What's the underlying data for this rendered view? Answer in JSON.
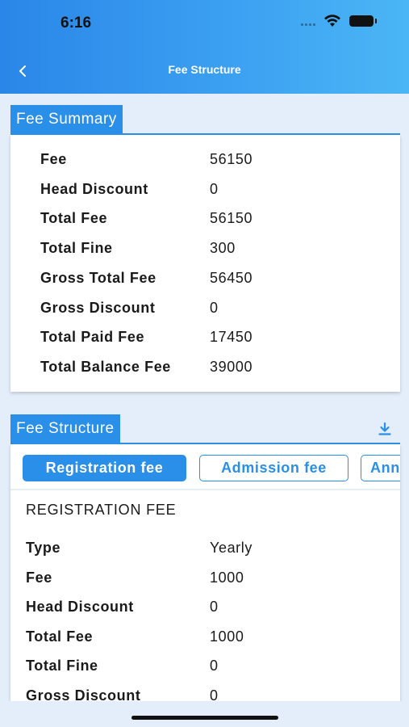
{
  "status_bar": {
    "time": "6:16"
  },
  "header": {
    "title": "Fee Structure"
  },
  "fee_summary": {
    "tab_label": "Fee Summary",
    "rows": [
      {
        "label": "Fee",
        "value": "56150"
      },
      {
        "label": "Head Discount",
        "value": "0"
      },
      {
        "label": "Total Fee",
        "value": "56150"
      },
      {
        "label": "Total Fine",
        "value": "300"
      },
      {
        "label": "Gross Total Fee",
        "value": "56450"
      },
      {
        "label": "Gross Discount",
        "value": "0"
      },
      {
        "label": "Total Paid Fee",
        "value": "17450"
      },
      {
        "label": "Total Balance Fee",
        "value": "39000"
      }
    ]
  },
  "fee_structure": {
    "tab_label": "Fee Structure",
    "chips": [
      {
        "label": "Registration fee",
        "active": true
      },
      {
        "label": "Admission fee",
        "active": false
      },
      {
        "label": "Ann",
        "active": false
      }
    ],
    "section_title": "REGISTRATION FEE",
    "rows": [
      {
        "label": "Type",
        "value": "Yearly"
      },
      {
        "label": "Fee",
        "value": "1000"
      },
      {
        "label": "Head Discount",
        "value": "0"
      },
      {
        "label": "Total Fee",
        "value": "1000"
      },
      {
        "label": "Total Fine",
        "value": "0"
      },
      {
        "label": "Gross Discount",
        "value": "0"
      }
    ]
  },
  "colors": {
    "accent": "#2a8fe8",
    "background": "#e3eefa",
    "header_start": "#2a86e8",
    "header_end": "#4ab6f5"
  }
}
